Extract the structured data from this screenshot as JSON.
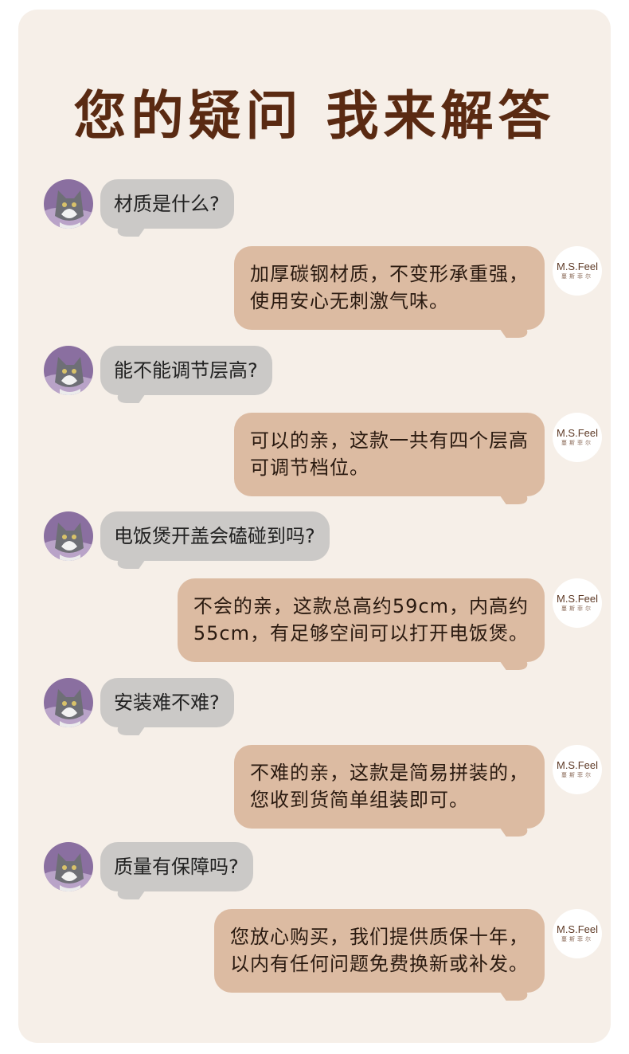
{
  "title": "您的疑问 我来解答",
  "logo": {
    "main": "M.S.Feel",
    "sub": "蔓斯菲尔"
  },
  "faq": [
    {
      "question": "材质是什么?",
      "answer": [
        "加厚碳钢材质，不变形承重强，",
        "使用安心无刺激气味。"
      ]
    },
    {
      "question": "能不能调节层高?",
      "answer": [
        "可以的亲，这款一共有四个层高",
        "可调节档位。"
      ]
    },
    {
      "question": "电饭煲开盖会磕碰到吗?",
      "answer": [
        "不会的亲，这款总高约59cm，内高约",
        "55cm，有足够空间可以打开电饭煲。"
      ]
    },
    {
      "question": "安装难不难?",
      "answer": [
        "不难的亲，这款是简易拼装的，",
        "您收到货简单组装即可。"
      ]
    },
    {
      "question": "质量有保障吗?",
      "answer": [
        "您放心购买，我们提供质保十年，",
        "以内有任何问题免费换新或补发。"
      ]
    }
  ],
  "colors": {
    "title": "#5a2a12",
    "question_bubble": "#cbc9c7",
    "answer_bubble": "#dcbba2",
    "card": "#f6efe8"
  },
  "icons": {
    "user": "cat-avatar-icon",
    "brand": "ms-feel-logo-icon"
  }
}
